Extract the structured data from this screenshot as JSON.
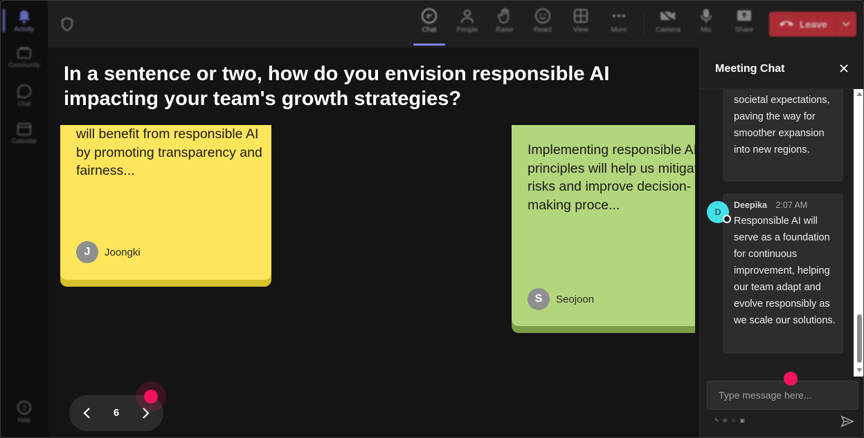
{
  "rail": {
    "items": [
      {
        "label": "Activity",
        "icon": "bell-icon"
      },
      {
        "label": "Community",
        "icon": "community-icon"
      },
      {
        "label": "Chat",
        "icon": "chat-icon"
      },
      {
        "label": "Calendar",
        "icon": "calendar-icon"
      },
      {
        "label": "Help",
        "icon": "help-icon"
      }
    ]
  },
  "toolbar": {
    "chat": "Chat",
    "people": "People",
    "raise": "Raise",
    "react": "React",
    "view": "View",
    "more": "More",
    "camera": "Camera",
    "mic": "Mic",
    "share": "Share",
    "leave": "Leave"
  },
  "question": "In a sentence or two, how do you envision responsible AI impacting your team's growth strategies?",
  "notes": [
    {
      "text": "will benefit from responsible AI by promoting transparency and fairness...",
      "author_initial": "J",
      "author": "Joongki",
      "color": "#fde55c"
    },
    {
      "text": "Implementing responsible AI principles will help us mitigate risks and improve decision-making proce...",
      "author_initial": "S",
      "author": "Seojoon",
      "color": "#b3d67c"
    }
  ],
  "pager": {
    "page": "6"
  },
  "chat": {
    "title": "Meeting Chat",
    "messages": [
      {
        "text": "societal expectations, paving the way for smoother expansion into new regions."
      },
      {
        "sender": "Deepika",
        "time": "2:07 AM",
        "avatar": "D",
        "text": "Responsible AI will serve as a foundation for continuous improvement, helping our team adapt and evolve responsibly as we scale our solutions."
      }
    ],
    "input_placeholder": "Type message here..."
  },
  "colors": {
    "accent": "#7f85f5",
    "leave": "#c4313b",
    "marker": "#f0145f",
    "avatar_deepika": "#42e0e6"
  }
}
